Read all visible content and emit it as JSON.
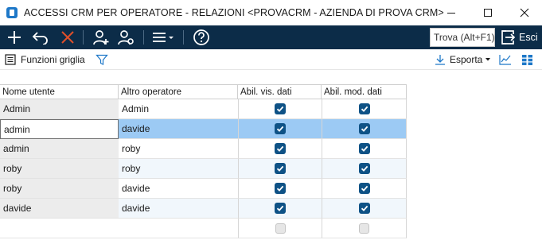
{
  "window": {
    "title": "ACCESSI CRM PER OPERATORE - RELAZIONI <PROVACRM - AZIENDA DI PROVA CRM>"
  },
  "toolbar": {
    "icons": [
      "add-icon",
      "undo-icon",
      "delete-icon",
      "add-user-icon",
      "users-icon",
      "menu-icon",
      "help-icon"
    ],
    "search_label": "Trova (Alt+F1)",
    "exit_label": "Esci"
  },
  "subbar": {
    "grid_functions_label": "Funzioni griglia",
    "export_label": "Esporta"
  },
  "grid": {
    "columns": [
      "Nome utente",
      "Altro operatore",
      "Abil. vis. dati",
      "Abil. mod. dati"
    ],
    "rows": [
      {
        "user": "Admin",
        "other": "Admin",
        "view": true,
        "edit": true
      },
      {
        "user": "admin",
        "other": "davide",
        "view": true,
        "edit": true
      },
      {
        "user": "admin",
        "other": "roby",
        "view": true,
        "edit": true
      },
      {
        "user": "roby",
        "other": "roby",
        "view": true,
        "edit": true
      },
      {
        "user": "roby",
        "other": "davide",
        "view": true,
        "edit": true
      },
      {
        "user": "davide",
        "other": "davide",
        "view": true,
        "edit": true
      },
      {
        "user": "",
        "other": "",
        "view": false,
        "edit": false
      }
    ]
  },
  "colors": {
    "toolbar_bg": "#0c2c48",
    "selected_row": "#9ccaf4",
    "checkbox_checked": "#0e5286",
    "delete_icon": "#e0502a"
  }
}
